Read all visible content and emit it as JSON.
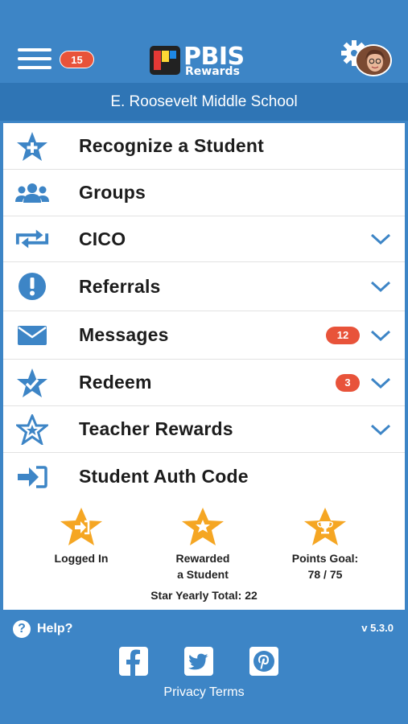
{
  "header": {
    "notification_count": "15",
    "logo_text_top": "PBIS",
    "logo_text_bottom": "Rewards"
  },
  "school_name": "E. Roosevelt Middle School",
  "menu": [
    {
      "label": "Recognize a Student",
      "icon": "star-plus-icon"
    },
    {
      "label": "Groups",
      "icon": "users-icon"
    },
    {
      "label": "CICO",
      "icon": "swap-arrows-icon"
    },
    {
      "label": "Referrals",
      "icon": "exclamation-circle-icon"
    },
    {
      "label": "Messages",
      "icon": "envelope-icon",
      "count": "12"
    },
    {
      "label": "Redeem",
      "icon": "star-check-icon",
      "count": "3"
    },
    {
      "label": "Teacher Rewards",
      "icon": "star-outline-icon"
    },
    {
      "label": "Student Auth Code",
      "icon": "sign-in-icon"
    }
  ],
  "stats": {
    "logged_in": "Logged In",
    "rewarded_line1": "Rewarded",
    "rewarded_line2": "a Student",
    "points_goal_label": "Points Goal:",
    "points_goal_value": "78 / 75",
    "yearly_total": "Star Yearly Total: 22"
  },
  "footer": {
    "help_label": "Help?",
    "version": "v 5.3.0",
    "privacy": "Privacy Terms"
  },
  "colors": {
    "primary_blue": "#3d85c6",
    "dark_blue": "#2f75b5",
    "badge_red": "#e8533a",
    "star_orange": "#f5a623"
  }
}
